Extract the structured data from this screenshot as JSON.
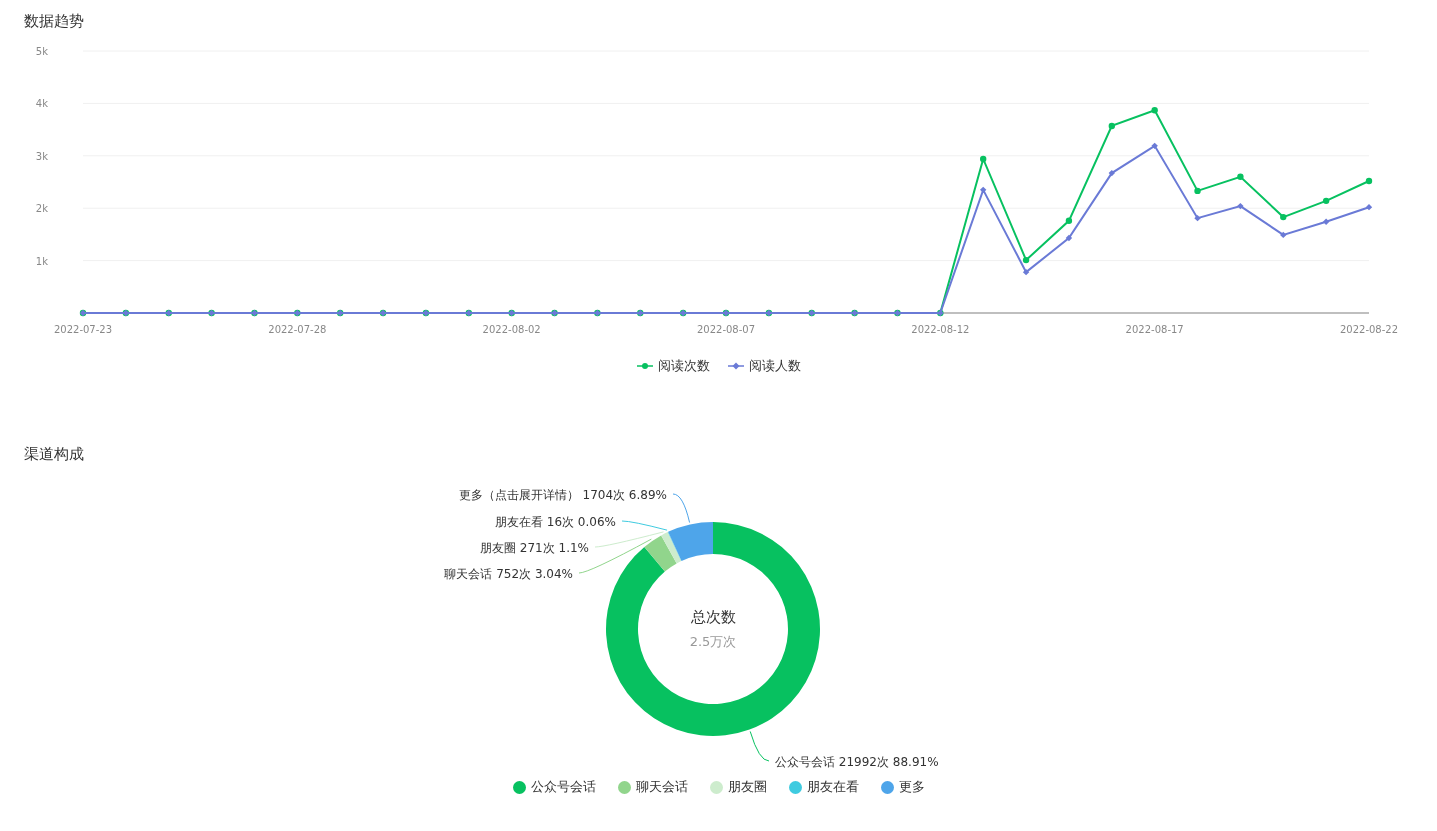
{
  "trend": {
    "title": "数据趋势",
    "chart_data": {
      "type": "line",
      "x": [
        "2022-07-23",
        "2022-07-24",
        "2022-07-25",
        "2022-07-26",
        "2022-07-27",
        "2022-07-28",
        "2022-07-29",
        "2022-07-30",
        "2022-07-31",
        "2022-08-01",
        "2022-08-02",
        "2022-08-03",
        "2022-08-04",
        "2022-08-05",
        "2022-08-06",
        "2022-08-07",
        "2022-08-08",
        "2022-08-09",
        "2022-08-10",
        "2022-08-11",
        "2022-08-12",
        "2022-08-13",
        "2022-08-14",
        "2022-08-15",
        "2022-08-16",
        "2022-08-17",
        "2022-08-18",
        "2022-08-19",
        "2022-08-20",
        "2022-08-21",
        "2022-08-22"
      ],
      "series": [
        {
          "name": "阅读次数",
          "color": "#07c160",
          "marker": "circle",
          "values": [
            0,
            0,
            0,
            0,
            0,
            0,
            0,
            0,
            0,
            0,
            0,
            0,
            0,
            0,
            0,
            0,
            0,
            0,
            0,
            0,
            0,
            2940,
            1010,
            1760,
            3570,
            3870,
            2330,
            2600,
            1830,
            2140,
            2520
          ]
        },
        {
          "name": "阅读人数",
          "color": "#6a7ad6",
          "marker": "diamond",
          "values": [
            0,
            0,
            0,
            0,
            0,
            0,
            0,
            0,
            0,
            0,
            0,
            0,
            0,
            0,
            0,
            0,
            0,
            0,
            0,
            0,
            0,
            2350,
            780,
            1430,
            2670,
            3190,
            1810,
            2040,
            1490,
            1740,
            2020
          ]
        }
      ],
      "xlim": [
        "2022-07-23",
        "2022-08-22"
      ],
      "grid": true,
      "ylim": [
        0,
        5000
      ],
      "yticks": [
        {
          "value": 1000,
          "label": "1k"
        },
        {
          "value": 2000,
          "label": "2k"
        },
        {
          "value": 3000,
          "label": "3k"
        },
        {
          "value": 4000,
          "label": "4k"
        },
        {
          "value": 5000,
          "label": "5k"
        }
      ],
      "xticks": [
        "2022-07-23",
        "2022-07-28",
        "2022-08-02",
        "2022-08-07",
        "2022-08-12",
        "2022-08-17",
        "2022-08-22"
      ]
    }
  },
  "channels": {
    "title": "渠道构成",
    "center_title": "总次数",
    "center_value": "2.5万次",
    "chart_data": {
      "type": "donut",
      "categories": [
        "公众号会话",
        "聊天会话",
        "朋友圈",
        "朋友在看",
        "更多"
      ],
      "values": [
        88.91,
        3.04,
        1.1,
        0.06,
        6.89
      ],
      "colors": [
        "#07c160",
        "#91d58c",
        "#cdeccd",
        "#3fcbe0",
        "#4ea5ea"
      ],
      "value_labels": [
        "公众号会话 21992次 88.91%",
        "聊天会话 752次 3.04%",
        "朋友圈 271次 1.1%",
        "朋友在看 16次 0.06%",
        "更多（点击展开详情） 1704次 6.89%"
      ]
    }
  }
}
